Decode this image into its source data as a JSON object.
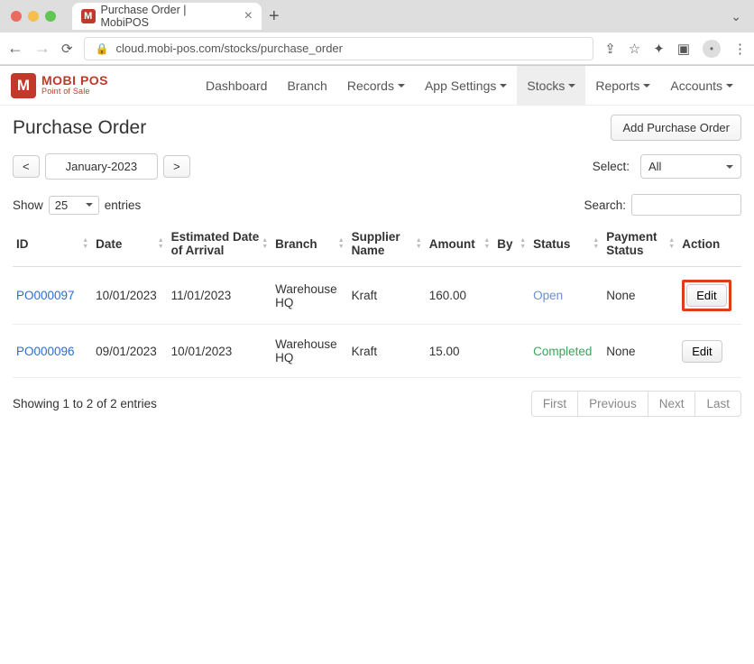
{
  "browser": {
    "tab_title": "Purchase Order | MobiPOS",
    "url": "cloud.mobi-pos.com/stocks/purchase_order"
  },
  "logo": {
    "line1": "MOBI POS",
    "line2": "Point of Sale"
  },
  "nav": {
    "dashboard": "Dashboard",
    "branch": "Branch",
    "records": "Records",
    "app_settings": "App Settings",
    "stocks": "Stocks",
    "reports": "Reports",
    "accounts": "Accounts"
  },
  "page": {
    "title": "Purchase Order",
    "add_btn": "Add Purchase Order",
    "prev_btn": "<",
    "next_btn": ">",
    "month": "January-2023",
    "select_label": "Select:",
    "select_value": "All",
    "show_label": "Show",
    "entries_label": "entries",
    "page_len": "25",
    "search_label": "Search:",
    "info": "Showing 1 to 2 of 2 entries"
  },
  "columns": {
    "id": "ID",
    "date": "Date",
    "eta": "Estimated Date of Arrival",
    "branch": "Branch",
    "supplier": "Supplier Name",
    "amount": "Amount",
    "by": "By",
    "status": "Status",
    "pay_status": "Payment Status",
    "action": "Action"
  },
  "rows": [
    {
      "id": "PO000097",
      "date": "10/01/2023",
      "eta": "11/01/2023",
      "branch": "Warehouse HQ",
      "supplier": "Kraft",
      "amount": "160.00",
      "by": "",
      "status": "Open",
      "status_class": "open",
      "pay_status": "None",
      "action": "Edit",
      "highlight": true
    },
    {
      "id": "PO000096",
      "date": "09/01/2023",
      "eta": "10/01/2023",
      "branch": "Warehouse HQ",
      "supplier": "Kraft",
      "amount": "15.00",
      "by": "",
      "status": "Completed",
      "status_class": "completed",
      "pay_status": "None",
      "action": "Edit",
      "highlight": false
    }
  ],
  "pager": {
    "first": "First",
    "prev": "Previous",
    "next": "Next",
    "last": "Last"
  }
}
